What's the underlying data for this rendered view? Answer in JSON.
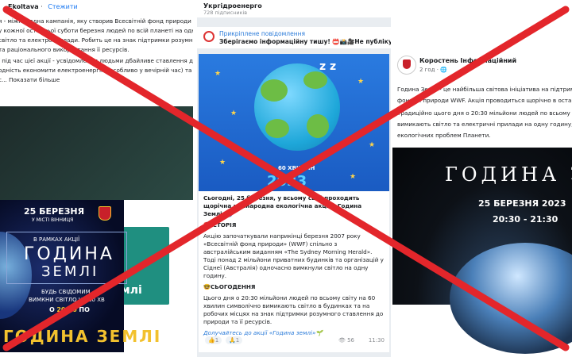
{
  "panel1": {
    "author": "Ekoltava",
    "follow": "Стежити",
    "paragraph1": [
      "я - міжнародна кампанія, яку створив Всесвітній фонд природи WWF.",
      "у кожної останньої суботи березня людей по всій планеті на одну годину символічно",
      "світло та електроприлади. Робить це на знак підтримки розумного ставлення до",
      "та раціонального використання її ресурсів."
    ],
    "paragraph2": [
      "ї під час цієї акції - усвідомлення людьми дбайливе ставлення до природи,",
      "одність економити електроенергію (особливо у вечірній час) та воду."
    ],
    "more": "с... Показати більше",
    "card": {
      "small": "Вимкніть світло",
      "big": "Година Землі"
    },
    "poster": {
      "date": "25 БЕРЕЗНЯ",
      "city": "У МІСТІ ВІННИЦЯ",
      "intro": "В РАМКАХ АКЦІЇ",
      "title1": "ГОДИНА",
      "title2": "ЗЕМЛІ",
      "line1": "БУДЬ СВІДОМИМ -",
      "line2": "ВИМКНИ СВІТЛО НА 60 ХВ",
      "line3_prefix": "О",
      "line3_time": "20:30",
      "line3_suffix": "ПО",
      "bottom": "ГОДИНА ЗЕМЛІ"
    }
  },
  "panel2": {
    "channel": "Укргідроенерго",
    "subscribers": "728 підписників",
    "pinned_label": "Прикріплене повідомлення",
    "pinned_text": "Зберігаємо інформаційну тишу! 📛📸🎥Не публікуйте ФО",
    "image": {
      "zz": "z z",
      "minutes": "60 ХВИЛИН",
      "year": "2023"
    },
    "intro": "Сьогодні, 25 березня, у всьому світі проходить щорічна міжнародна екологічна акція «Година Землі»🌏",
    "history_heading": "📚ІСТОРІЯ",
    "history_text": "Акцію започаткували наприкінці березня 2007 року «Всесвітній фонд природи» (WWF) спільно з австралійським виданням «The Sydney Morning Herald». Тоді понад 2 мільйони приватних будинків та організацій у Сіднеї (Австралія) одночасно вимкнули світло на одну годину.",
    "today_heading": "🤓СЬОГОДЕННЯ",
    "today_text": "Цього дня о 20:30 мільйони людей по всьому світу на 60 хвилин символічно вимикають світло в будинках та на робочих місцях на знак підтримки розумного ставлення до природи та її ресурсів.",
    "cta": "Долучайтесь до акції «Година землі»🌱",
    "reaction1": "👍1",
    "reaction2": "🙏1",
    "views": "👁 56",
    "time": "11:30"
  },
  "panel3": {
    "page": "Коростень Інформаційний",
    "meta": "2 год · 🌐",
    "paragraph1": [
      "Година Землі - це найбільша світова ініціатива на підтримку плане",
      "фондом природи WWF. Акція проводиться щорічно в останню суб"
    ],
    "paragraph2": [
      "Традиційно цього дня о 20:30 мільйони людей по всьому світу на",
      "вимикають світло та електричні прилади на одну годину, щоб пр",
      "екологічних проблем Планети."
    ],
    "image": {
      "title": "ГОДИНА ЗЕМ",
      "date": "25 БЕРЕЗНЯ 2023",
      "hours": "20:30 - 21:30"
    }
  },
  "colors": {
    "cross": "#e3262b",
    "link": "#2b7bd9",
    "facebook_blue": "#1877f2"
  }
}
